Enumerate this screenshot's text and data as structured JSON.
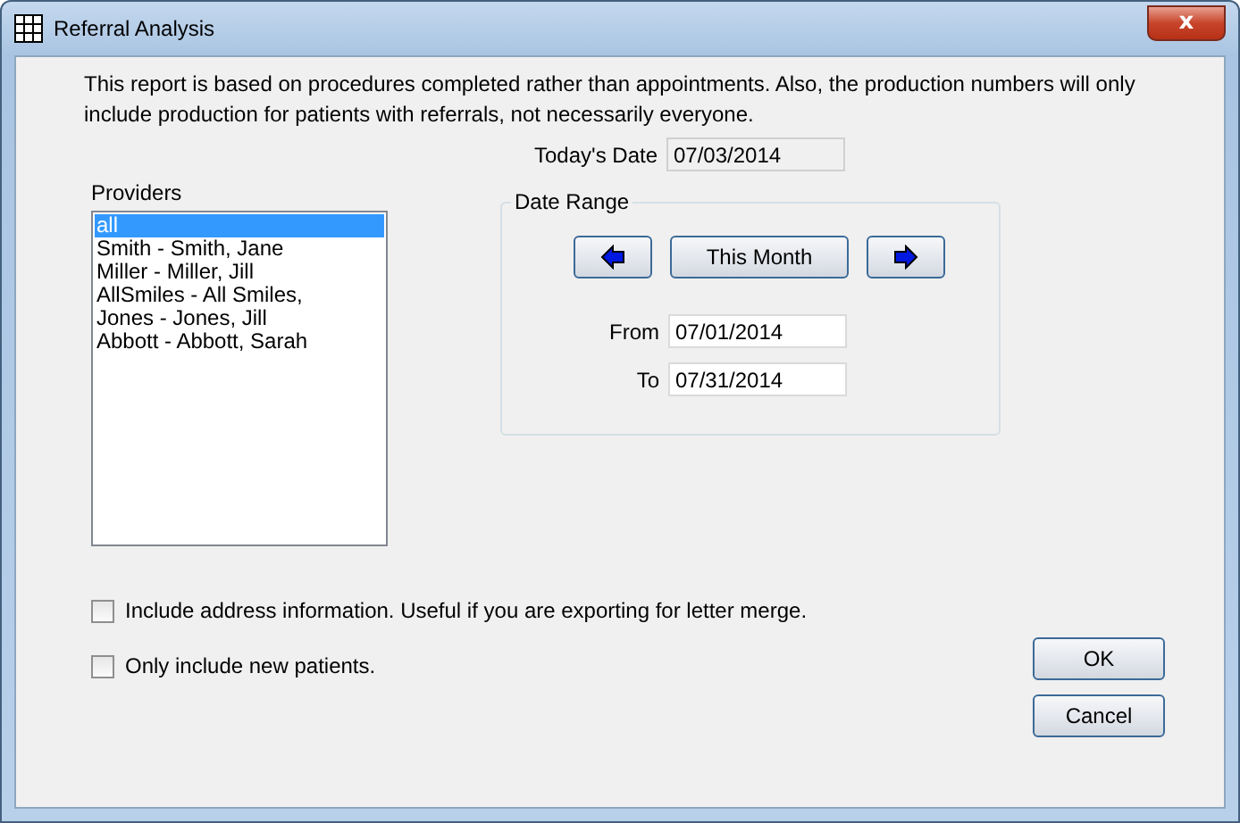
{
  "window": {
    "title": "Referral Analysis",
    "close_label": "x"
  },
  "description": "This report is based on procedures completed rather than appointments.  Also, the production numbers will only include production for patients with referrals, not necessarily everyone.",
  "providers": {
    "label": "Providers",
    "items": [
      {
        "label": "all",
        "selected": true
      },
      {
        "label": "Smith - Smith, Jane",
        "selected": false
      },
      {
        "label": "Miller - Miller, Jill",
        "selected": false
      },
      {
        "label": "AllSmiles - All Smiles,",
        "selected": false
      },
      {
        "label": "Jones - Jones, Jill",
        "selected": false
      },
      {
        "label": "Abbott - Abbott, Sarah",
        "selected": false
      }
    ]
  },
  "todays_date": {
    "label": "Today's Date",
    "value": "07/03/2014"
  },
  "date_range": {
    "title": "Date Range",
    "this_month": "This Month",
    "from": {
      "label": "From",
      "value": "07/01/2014"
    },
    "to": {
      "label": "To",
      "value": "07/31/2014"
    }
  },
  "options": [
    {
      "label": "Include address information.  Useful if you are exporting for letter merge.",
      "checked": false
    },
    {
      "label": "Only include new patients.",
      "checked": false
    }
  ],
  "buttons": [
    "OK",
    "Cancel"
  ]
}
